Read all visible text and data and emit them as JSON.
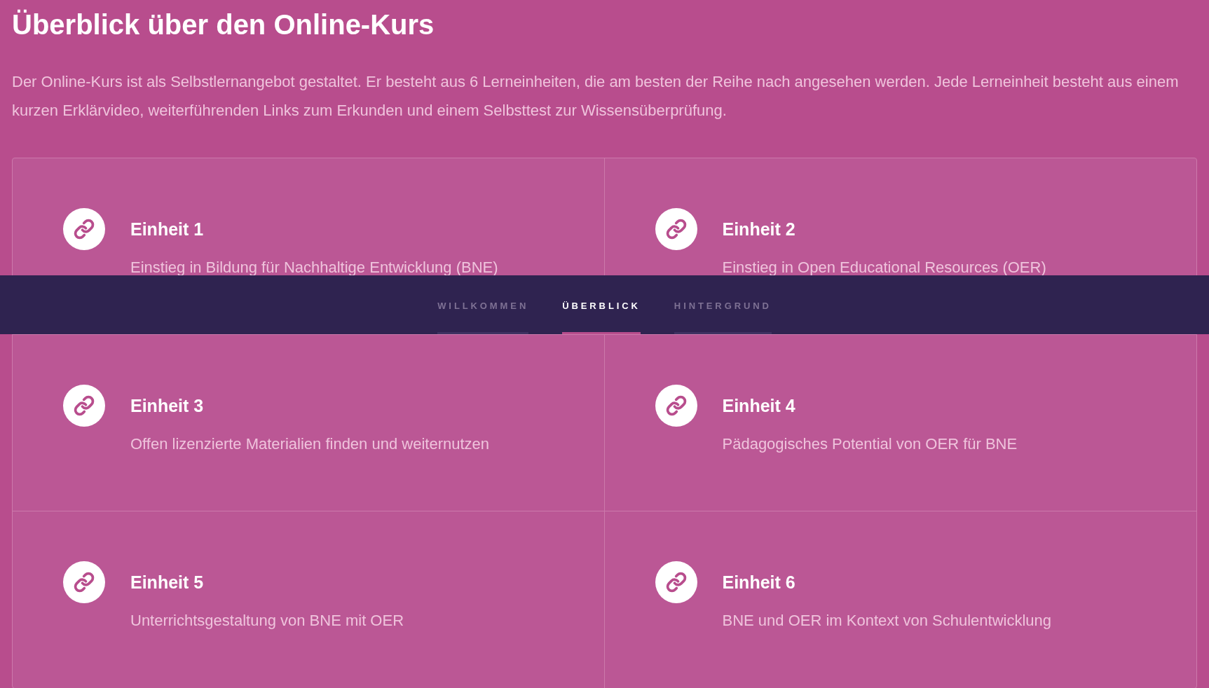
{
  "heading": "Überblick über den Online-Kurs",
  "intro": "Der Online-Kurs ist als Selbstlernangebot gestaltet. Er besteht aus 6 Lerneinheiten, die am besten der Reihe nach angesehen werden. Jede Lerneinheit besteht aus einem kurzen Erklärvideo, weiterführenden Links zum Erkunden und einem Selbsttest zur Wissensüberprüfung.",
  "units": [
    {
      "title": "Einheit 1",
      "description": "Einstieg in Bildung für Nachhaltige Entwicklung (BNE)"
    },
    {
      "title": "Einheit 2",
      "description": "Einstieg in Open Educational Resources (OER)"
    },
    {
      "title": "Einheit 3",
      "description": "Offen lizenzierte Materialien finden und weiternutzen"
    },
    {
      "title": "Einheit 4",
      "description": "Pädagogisches Potential von OER für BNE"
    },
    {
      "title": "Einheit 5",
      "description": "Unterrichtsgestaltung von BNE mit OER"
    },
    {
      "title": "Einheit 6",
      "description": "BNE und OER im Kontext von Schulentwicklung"
    }
  ],
  "nav": [
    {
      "label": "WILLKOMMEN",
      "selected": false
    },
    {
      "label": "ÜBERBLICK",
      "selected": true
    },
    {
      "label": "HINTERGRUND",
      "selected": false
    }
  ]
}
